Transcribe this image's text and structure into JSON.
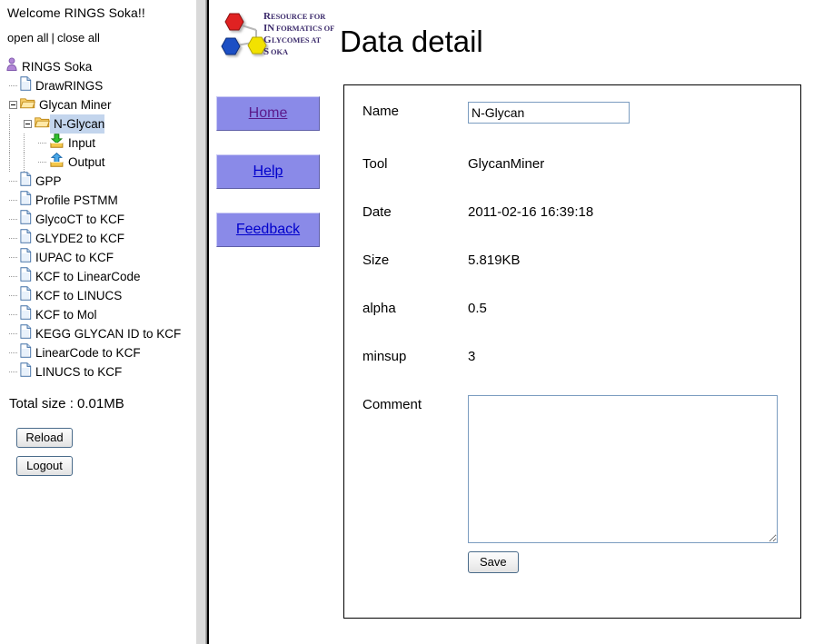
{
  "sidebar": {
    "welcome": "Welcome RINGS Soka!!",
    "open_all": "open all",
    "separator": "|",
    "close_all": "close all",
    "tree": [
      {
        "label": "RINGS Soka",
        "icon": "user-icon",
        "depth": 0,
        "expander": "none",
        "selected": false
      },
      {
        "label": "DrawRINGS",
        "icon": "file-icon",
        "depth": 1,
        "expander": "none",
        "selected": false
      },
      {
        "label": "Glycan Miner",
        "icon": "folder-icon",
        "depth": 1,
        "expander": "collapse",
        "selected": false
      },
      {
        "label": "N-Glycan",
        "icon": "folder-icon",
        "depth": 2,
        "expander": "collapse",
        "selected": true
      },
      {
        "label": "Input",
        "icon": "input-icon",
        "depth": 3,
        "expander": "none",
        "selected": false
      },
      {
        "label": "Output",
        "icon": "output-icon",
        "depth": 3,
        "expander": "none",
        "selected": false
      },
      {
        "label": "GPP",
        "icon": "file-icon",
        "depth": 1,
        "expander": "none",
        "selected": false
      },
      {
        "label": "Profile PSTMM",
        "icon": "file-icon",
        "depth": 1,
        "expander": "none",
        "selected": false
      },
      {
        "label": "GlycoCT to KCF",
        "icon": "file-icon",
        "depth": 1,
        "expander": "none",
        "selected": false
      },
      {
        "label": "GLYDE2 to KCF",
        "icon": "file-icon",
        "depth": 1,
        "expander": "none",
        "selected": false
      },
      {
        "label": "IUPAC to KCF",
        "icon": "file-icon",
        "depth": 1,
        "expander": "none",
        "selected": false
      },
      {
        "label": "KCF to LinearCode",
        "icon": "file-icon",
        "depth": 1,
        "expander": "none",
        "selected": false
      },
      {
        "label": "KCF to LINUCS",
        "icon": "file-icon",
        "depth": 1,
        "expander": "none",
        "selected": false
      },
      {
        "label": "KCF to Mol",
        "icon": "file-icon",
        "depth": 1,
        "expander": "none",
        "selected": false
      },
      {
        "label": "KEGG GLYCAN ID to KCF",
        "icon": "file-icon",
        "depth": 1,
        "expander": "none",
        "selected": false
      },
      {
        "label": "LinearCode to KCF",
        "icon": "file-icon",
        "depth": 1,
        "expander": "none",
        "selected": false
      },
      {
        "label": "LINUCS to KCF",
        "icon": "file-icon",
        "depth": 1,
        "expander": "none",
        "selected": false
      }
    ],
    "total_size": "Total size : 0.01MB",
    "reload_label": "Reload",
    "logout_label": "Logout"
  },
  "header": {
    "title": "Data detail",
    "logo": {
      "name": "rings-logo",
      "lines": [
        {
          "cap": "R",
          "rest": "ESOURCE FOR"
        },
        {
          "cap": "IN",
          "rest": "FORMATICS OF"
        },
        {
          "cap": "G",
          "rest": "LYCOMES AT"
        },
        {
          "cap": "S",
          "rest": "OKA"
        }
      ],
      "colors": {
        "red": "#e02020",
        "blue": "#1a4fc4",
        "yellow": "#f2e200",
        "text": "#3b2a6b"
      }
    }
  },
  "nav": {
    "home_label": "Home",
    "help_label": "Help",
    "feedback_label": "Feedback",
    "link_color": "#0000cc",
    "visited_color": "#5b1a8b",
    "button_bg": "#8a8ae8"
  },
  "form": {
    "name_label": "Name",
    "name_value": "N-Glycan",
    "name_placeholder": "",
    "tool_label": "Tool",
    "tool_value": "GlycanMiner",
    "date_label": "Date",
    "date_value": "2011-02-16 16:39:18",
    "size_label": "Size",
    "size_value": "5.819KB",
    "alpha_label": "alpha",
    "alpha_value": "0.5",
    "minsup_label": "minsup",
    "minsup_value": "3",
    "comment_label": "Comment",
    "comment_value": "",
    "comment_placeholder": "",
    "save_label": "Save"
  }
}
